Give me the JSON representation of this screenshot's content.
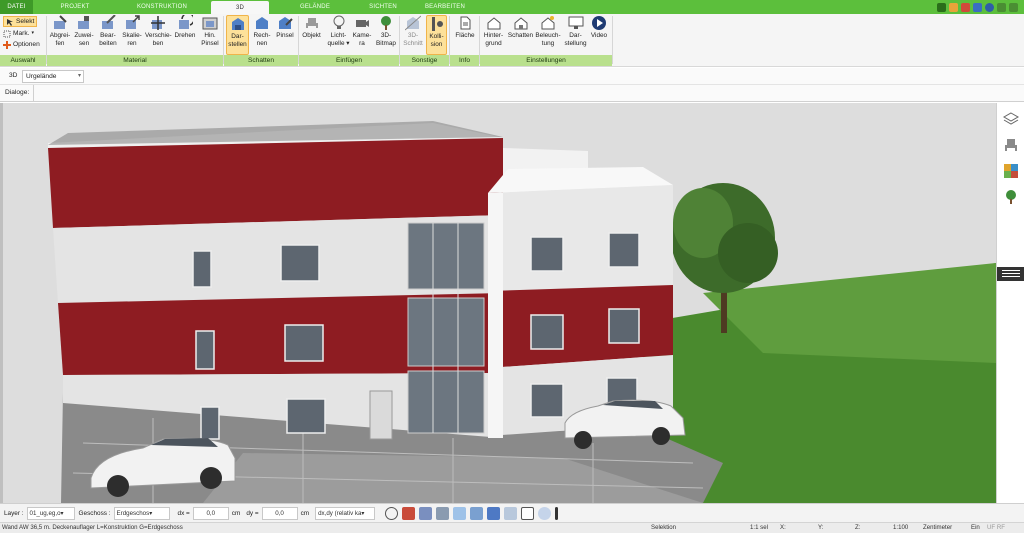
{
  "tabs": [
    {
      "label": "DATEI"
    },
    {
      "label": "PROJEKT"
    },
    {
      "label": "KONSTRUKTION"
    },
    {
      "label": "3D"
    },
    {
      "label": "GELÄNDE"
    },
    {
      "label": "SICHTEN"
    },
    {
      "label": "BEARBEITEN"
    }
  ],
  "active_tab": "3D",
  "auswahl": {
    "selekt": "Selekt",
    "mark": "Mark.",
    "optionen": "Optionen",
    "group": "Auswahl"
  },
  "material": {
    "buttons": [
      {
        "line1": "Abgrei-",
        "line2": "fen",
        "icon": "eyedropper-icon"
      },
      {
        "line1": "Zuwei-",
        "line2": "sen",
        "icon": "paint-assign-icon"
      },
      {
        "line1": "Bear-",
        "line2": "beiten",
        "icon": "brush-edit-icon"
      },
      {
        "line1": "Skalie-",
        "line2": "ren",
        "icon": "scale-icon"
      },
      {
        "line1": "Verschie-",
        "line2": "ben",
        "icon": "move-icon"
      },
      {
        "line1": "Drehen",
        "line2": "",
        "icon": "rotate-icon"
      },
      {
        "line1": "Hin.",
        "line2": "Pinsel",
        "icon": "background-brush-icon"
      }
    ],
    "group": "Material"
  },
  "schatten": {
    "buttons": [
      {
        "line1": "Dar-",
        "line2": "stellen",
        "icon": "shadow-display-icon",
        "active": true
      },
      {
        "line1": "Rech-",
        "line2": "nen",
        "icon": "shadow-calc-icon"
      },
      {
        "line1": "Pinsel",
        "line2": "",
        "icon": "shadow-brush-icon"
      }
    ],
    "group": "Schatten"
  },
  "einfuegen": {
    "buttons": [
      {
        "line1": "Objekt",
        "line2": "",
        "icon": "chair-icon"
      },
      {
        "line1": "Licht-",
        "line2": "quelle ▾",
        "icon": "lightbulb-icon"
      },
      {
        "line1": "Kame-",
        "line2": "ra",
        "icon": "camera-icon"
      },
      {
        "line1": "3D-",
        "line2": "Bitmap",
        "icon": "tree-icon"
      }
    ],
    "group": "Einfügen"
  },
  "sonstige": {
    "buttons": [
      {
        "line1": "3D-",
        "line2": "Schnitt",
        "icon": "section-icon",
        "disabled": true
      },
      {
        "line1": "Kolli-",
        "line2": "sion",
        "icon": "collision-icon",
        "active": true
      }
    ],
    "group": "Sonstige"
  },
  "info": {
    "buttons": [
      {
        "line1": "Fläche",
        "line2": "",
        "icon": "area-icon"
      }
    ],
    "group": "Info"
  },
  "einstellungen": {
    "buttons": [
      {
        "line1": "Hinter-",
        "line2": "grund",
        "icon": "background-icon"
      },
      {
        "line1": "Schatten",
        "line2": "",
        "icon": "house-shadow-icon"
      },
      {
        "line1": "Beleuch-",
        "line2": "tung",
        "icon": "house-light-icon"
      },
      {
        "line1": "Dar-",
        "line2": "stellung",
        "icon": "display-icon"
      },
      {
        "line1": "Video",
        "line2": "",
        "icon": "play-icon"
      }
    ],
    "group": "Einstellungen"
  },
  "view_row": {
    "mode": "3D",
    "dropdown": "Urgelände"
  },
  "dialog_row": {
    "label": "Dialoge:"
  },
  "right_strip": [
    "layers-icon",
    "chair-icon",
    "material-palette-icon",
    "tree-icon",
    "menu-icon"
  ],
  "bottom": {
    "layer_label": "Layer :",
    "layer_value": "01_ug,eg,o▾",
    "geschoss_label": "Geschoss :",
    "geschoss_value": "Erdgeschos▾",
    "dx_label": "dx =",
    "dx_value": "0,0",
    "dx_unit": "cm",
    "dy_label": "dy =",
    "dy_value": "0,0",
    "dy_unit": "cm",
    "mode_value": "dx,dy (relativ ka▾"
  },
  "status": {
    "message": "Wand AW 36,5 m. Deckenauflager L=Konstruktion G=Erdgeschoss",
    "selection": "Selektion",
    "sel_count": "1:1 sel",
    "x": "X:",
    "y": "Y:",
    "z": "Z:",
    "scale": "1:100",
    "unit": "Zentimeter",
    "ein": "Ein",
    "flags": "UF RF"
  },
  "colors": {
    "accent_green": "#5cbf3c",
    "group_label_green": "#b9e08d",
    "facade_red": "#8e1c22",
    "facade_white": "#e4e4e4",
    "lawn": "#4a8a2e"
  }
}
